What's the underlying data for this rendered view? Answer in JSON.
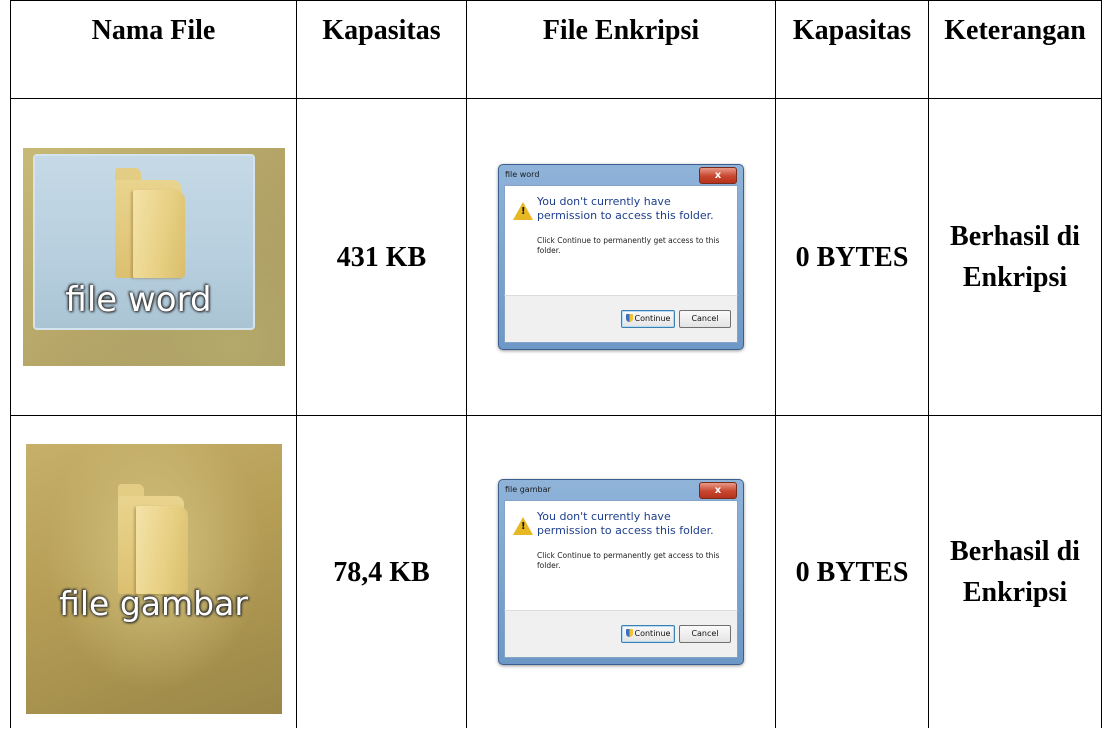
{
  "table": {
    "headers": [
      "Nama File",
      "Kapasitas",
      "File Enkripsi",
      "Kapasitas",
      "Keterangan"
    ],
    "rows": [
      {
        "file_label": "file word",
        "size_before": "431 KB",
        "dialog": {
          "title": "file word",
          "close": "x",
          "message": "You don't currently have permission to access this folder.",
          "sub_message": "Click Continue to permanently get access to this folder.",
          "continue_label": "Continue",
          "cancel_label": "Cancel"
        },
        "size_after": "0 BYTES",
        "note_line1": "Berhasil di",
        "note_line2": "Enkripsi"
      },
      {
        "file_label": "file gambar",
        "size_before": "78,4 KB",
        "dialog": {
          "title": "file gambar",
          "close": "x",
          "message": "You don't currently have permission to access this folder.",
          "sub_message": "Click Continue to permanently get access to this folder.",
          "continue_label": "Continue",
          "cancel_label": "Cancel"
        },
        "size_after": "0 BYTES",
        "note_line1": "Berhasil di",
        "note_line2": "Enkripsi"
      }
    ]
  },
  "colors": {
    "dialog_frame": "#8fb3d9",
    "dialog_close": "#c8452e",
    "warning_icon": "#e8b824",
    "message_text": "#1e3e8c"
  },
  "icons": [
    "folder-icon",
    "warning-icon",
    "shield-icon",
    "close-icon"
  ]
}
